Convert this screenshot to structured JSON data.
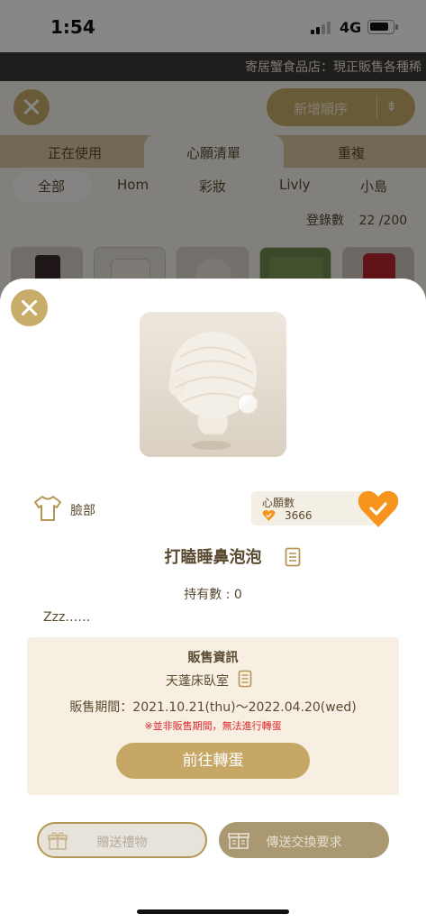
{
  "status_bar": {
    "time": "1:54",
    "network": "4G"
  },
  "background": {
    "marquee": "寄居蟹食品店：現正販售各種稀",
    "sort_label": "新增順序",
    "tabs": [
      "正在使用",
      "心願清單",
      "重複"
    ],
    "active_tab": "心願清單",
    "chips": [
      "全部",
      "Hom",
      "彩妝",
      "Livly",
      "小島"
    ],
    "active_chip": "全部",
    "count_label": "登錄數",
    "count_value": "22 /200"
  },
  "item": {
    "category": "臉部",
    "name": "打瞌睡鼻泡泡",
    "owned": "持有數 : 0",
    "description": "Zzz……"
  },
  "wishlist": {
    "title": "心願數",
    "count": "3666",
    "accent": "#f7941d"
  },
  "sale_info": {
    "title": "販售資訊",
    "shop": "天蓬床臥室",
    "period": "販售期間：2021.10.21(thu)～2022.04.20(wed)",
    "warning": "※並非販售期間，無法進行轉蛋",
    "button": "前往轉蛋"
  },
  "actions": {
    "gift": "贈送禮物",
    "trade": "傳送交換要求"
  },
  "icons": [
    "close-icon",
    "shirt-icon",
    "heart-check-icon",
    "book-icon",
    "gift-icon",
    "trade-icon",
    "sort-icon"
  ],
  "colors": {
    "gold": "#c8ac6a",
    "warning": "#e0282e",
    "text": "#5a4a30"
  }
}
